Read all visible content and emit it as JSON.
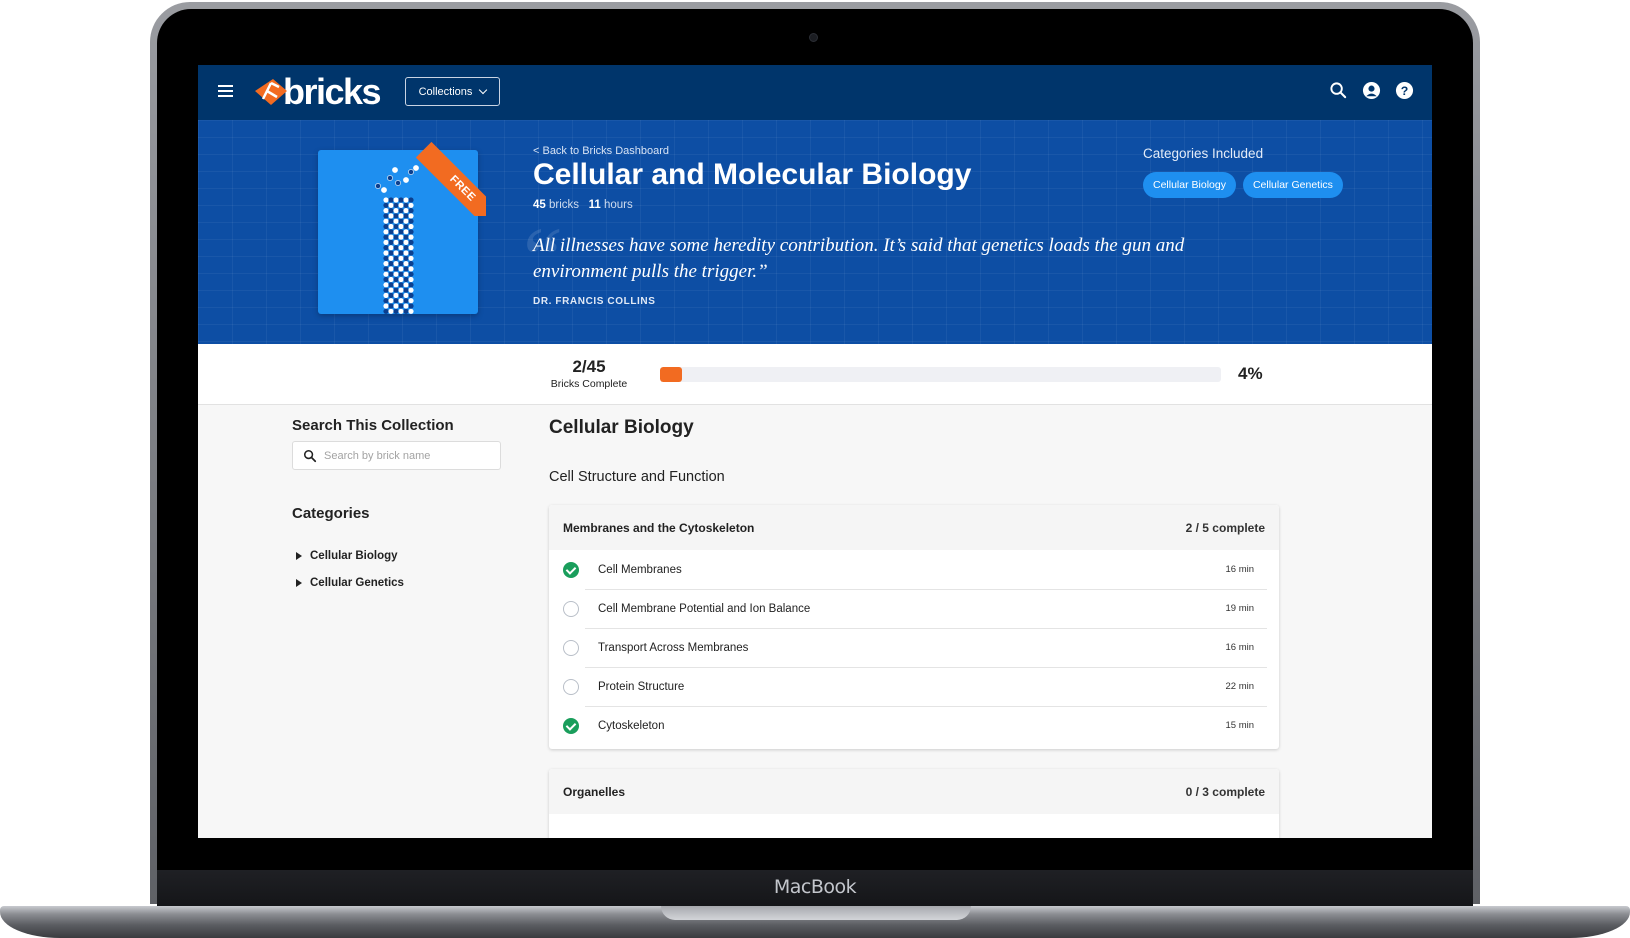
{
  "device": {
    "label": "MacBook"
  },
  "nav": {
    "logo_text": "bricks",
    "collections_label": "Collections",
    "icons": [
      "menu-icon",
      "search-icon",
      "account-icon",
      "help-icon"
    ]
  },
  "hero": {
    "back_link": "< Back to Bricks Dashboard",
    "title": "Cellular and Molecular Biology",
    "bricks_count": "45",
    "bricks_label": "bricks",
    "hours_count": "11",
    "hours_label": "hours",
    "badge": "FREE",
    "quote": "All illnesses have some heredity contribution. It’s said that genetics loads the gun and environment pulls the trigger.”",
    "quote_author": "DR. FRANCIS COLLINS",
    "categories_label": "Categories Included",
    "categories": [
      "Cellular Biology",
      "Cellular Genetics"
    ]
  },
  "progress": {
    "count": "2/45",
    "label": "Bricks Complete",
    "percent_text": "4%",
    "percent": 4
  },
  "sidebar": {
    "search_heading": "Search This Collection",
    "search_placeholder": "Search by brick name",
    "search_value": "",
    "categories_heading": "Categories",
    "categories": [
      "Cellular Biology",
      "Cellular Genetics"
    ]
  },
  "main": {
    "section_title": "Cellular Biology",
    "subsection_title": "Cell Structure and Function",
    "modules": [
      {
        "title": "Membranes and the Cytoskeleton",
        "complete": "2 / 5 complete",
        "bricks": [
          {
            "name": "Cell Membranes",
            "duration": "16 min",
            "done": true
          },
          {
            "name": "Cell Membrane Potential and Ion Balance",
            "duration": "19 min",
            "done": false
          },
          {
            "name": "Transport Across Membranes",
            "duration": "16 min",
            "done": false
          },
          {
            "name": "Protein Structure",
            "duration": "22 min",
            "done": false
          },
          {
            "name": "Cytoskeleton",
            "duration": "15 min",
            "done": true
          }
        ]
      },
      {
        "title": "Organelles",
        "complete": "0 / 3 complete",
        "bricks": []
      }
    ]
  },
  "colors": {
    "nav_bg": "#00356b",
    "hero_bg": "#0d4ea4",
    "accent_orange": "#f26b21",
    "chip_blue": "#1e8ff0",
    "done_green": "#1a9e5c"
  }
}
